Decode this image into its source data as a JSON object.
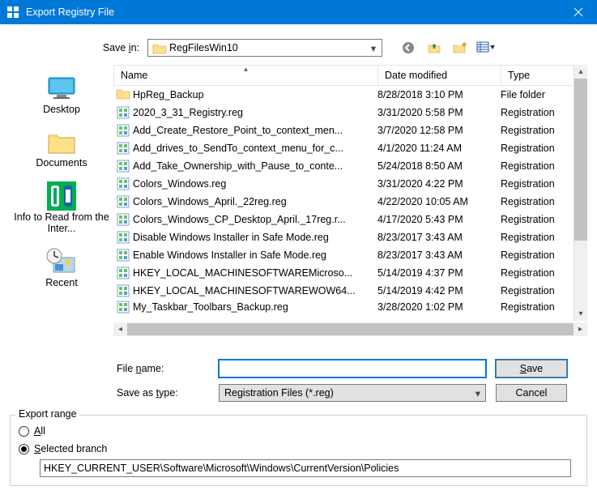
{
  "title": "Export Registry File",
  "savein": {
    "label_pre": "Save ",
    "label_under": "i",
    "label_post": "n:",
    "value": "RegFilesWin10"
  },
  "places": {
    "desktop": "Desktop",
    "documents": "Documents",
    "info": "Info to Read from the Inter...",
    "recent": "Recent"
  },
  "columns": {
    "name": "Name",
    "date": "Date modified",
    "type": "Type"
  },
  "files": [
    {
      "name": "HpReg_Backup",
      "date": "8/28/2018 3:10 PM",
      "type": "File folder",
      "kind": "folder"
    },
    {
      "name": "2020_3_31_Registry.reg",
      "date": "3/31/2020 5:58 PM",
      "type": "Registration",
      "kind": "reg"
    },
    {
      "name": "Add_Create_Restore_Point_to_context_men...",
      "date": "3/7/2020 12:58 PM",
      "type": "Registration",
      "kind": "reg"
    },
    {
      "name": "Add_drives_to_SendTo_context_menu_for_c...",
      "date": "4/1/2020 11:24 AM",
      "type": "Registration",
      "kind": "reg"
    },
    {
      "name": "Add_Take_Ownership_with_Pause_to_conte...",
      "date": "5/24/2018 8:50 AM",
      "type": "Registration",
      "kind": "reg"
    },
    {
      "name": "Colors_Windows.reg",
      "date": "3/31/2020 4:22 PM",
      "type": "Registration",
      "kind": "reg"
    },
    {
      "name": "Colors_Windows_April._22reg.reg",
      "date": "4/22/2020 10:05 AM",
      "type": "Registration",
      "kind": "reg"
    },
    {
      "name": "Colors_Windows_CP_Desktop_April._17reg.r...",
      "date": "4/17/2020 5:43 PM",
      "type": "Registration",
      "kind": "reg"
    },
    {
      "name": "Disable Windows Installer in Safe Mode.reg",
      "date": "8/23/2017 3:43 AM",
      "type": "Registration",
      "kind": "reg"
    },
    {
      "name": "Enable Windows Installer in Safe Mode.reg",
      "date": "8/23/2017 3:43 AM",
      "type": "Registration",
      "kind": "reg"
    },
    {
      "name": "HKEY_LOCAL_MACHINESOFTWAREMicroso...",
      "date": "5/14/2019 4:37 PM",
      "type": "Registration",
      "kind": "reg"
    },
    {
      "name": "HKEY_LOCAL_MACHINESOFTWAREWOW64...",
      "date": "5/14/2019 4:42 PM",
      "type": "Registration",
      "kind": "reg"
    },
    {
      "name": "My_Taskbar_Toolbars_Backup.reg",
      "date": "3/28/2020 1:02 PM",
      "type": "Registration",
      "kind": "reg"
    }
  ],
  "filename": {
    "label_pre": "File ",
    "label_under": "n",
    "label_post": "ame:",
    "value": ""
  },
  "savetype": {
    "label_pre": "Save as ",
    "label_under": "t",
    "label_post": "ype:",
    "value": "Registration Files (*.reg)"
  },
  "buttons": {
    "save_under": "S",
    "save_post": "ave",
    "cancel": "Cancel"
  },
  "export_range": {
    "legend": "Export range",
    "all_under": "A",
    "all_post": "ll",
    "selected_under": "S",
    "selected_post": "elected branch",
    "branch_value": "HKEY_CURRENT_USER\\Software\\Microsoft\\Windows\\CurrentVersion\\Policies"
  }
}
